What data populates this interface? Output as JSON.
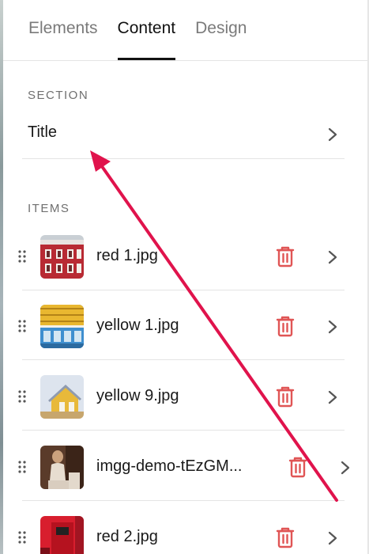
{
  "tabs": [
    {
      "label": "Elements",
      "active": false
    },
    {
      "label": "Content",
      "active": true
    },
    {
      "label": "Design",
      "active": false
    }
  ],
  "section": {
    "heading": "SECTION",
    "title_label": "Title"
  },
  "items_section": {
    "heading": "ITEMS",
    "items": [
      {
        "name": "red 1.jpg",
        "thumbnail": "red-building-facade"
      },
      {
        "name": "yellow 1.jpg",
        "thumbnail": "yellow-blue-facade"
      },
      {
        "name": "yellow 9.jpg",
        "thumbnail": "yellow-house-sky"
      },
      {
        "name": "imgg-demo-tEzGM...",
        "thumbnail": "person-seated-portrait"
      },
      {
        "name": "red 2.jpg",
        "thumbnail": "red-door"
      }
    ]
  },
  "colors": {
    "accent_delete": "#e05555",
    "annotation_arrow": "#e0134c",
    "active_tab": "#111111",
    "inactive_tab": "#7a7a7a"
  },
  "icons": {
    "chevron": "chevron-right-icon",
    "delete": "trash-icon",
    "drag": "drag-handle-icon"
  }
}
